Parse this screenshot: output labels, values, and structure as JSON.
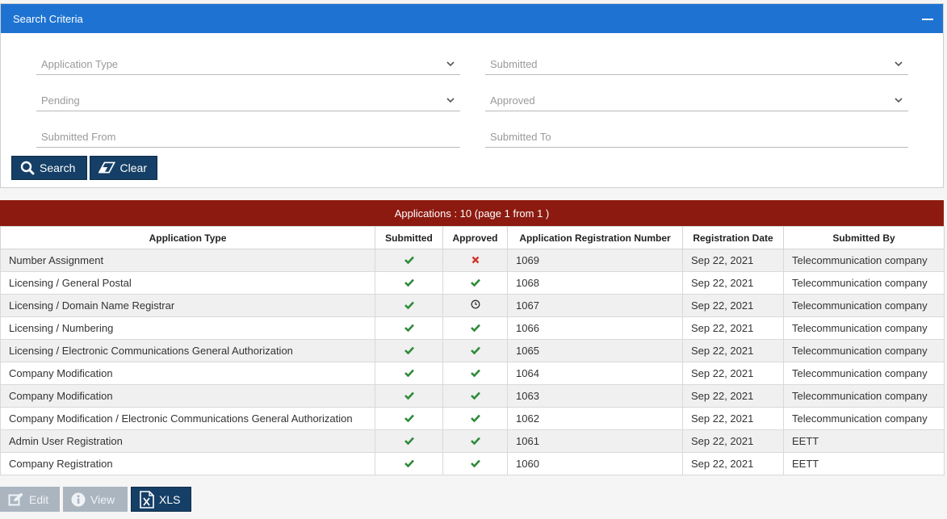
{
  "search_panel": {
    "title": "Search Criteria",
    "fields": {
      "application_type": "Application Type",
      "submitted": "Submitted",
      "pending": "Pending",
      "approved": "Approved",
      "submitted_from": "Submitted From",
      "submitted_to": "Submitted To"
    },
    "buttons": {
      "search": "Search",
      "clear": "Clear"
    }
  },
  "table": {
    "caption": "Applications : 10 (page 1 from 1 )",
    "columns": [
      "Application Type",
      "Submitted",
      "Approved",
      "Application Registration Number",
      "Registration Date",
      "Submitted By"
    ],
    "rows": [
      {
        "type": "Number Assignment",
        "submitted": "check",
        "approved": "cross",
        "number": "1069",
        "date": "Sep 22, 2021",
        "by": "Telecommunication company"
      },
      {
        "type": "Licensing / General Postal",
        "submitted": "check",
        "approved": "check",
        "number": "1068",
        "date": "Sep 22, 2021",
        "by": "Telecommunication company"
      },
      {
        "type": "Licensing / Domain Name Registrar",
        "submitted": "check",
        "approved": "clock",
        "number": "1067",
        "date": "Sep 22, 2021",
        "by": "Telecommunication company"
      },
      {
        "type": "Licensing / Numbering",
        "submitted": "check",
        "approved": "check",
        "number": "1066",
        "date": "Sep 22, 2021",
        "by": "Telecommunication company"
      },
      {
        "type": "Licensing / Electronic Communications General Authorization",
        "submitted": "check",
        "approved": "check",
        "number": "1065",
        "date": "Sep 22, 2021",
        "by": "Telecommunication company"
      },
      {
        "type": "Company Modification",
        "submitted": "check",
        "approved": "check",
        "number": "1064",
        "date": "Sep 22, 2021",
        "by": "Telecommunication company"
      },
      {
        "type": "Company Modification",
        "submitted": "check",
        "approved": "check",
        "number": "1063",
        "date": "Sep 22, 2021",
        "by": "Telecommunication company"
      },
      {
        "type": "Company Modification / Electronic Communications General Authorization",
        "submitted": "check",
        "approved": "check",
        "number": "1062",
        "date": "Sep 22, 2021",
        "by": "Telecommunication company"
      },
      {
        "type": "Admin User Registration",
        "submitted": "check",
        "approved": "check",
        "number": "1061",
        "date": "Sep 22, 2021",
        "by": "EETT"
      },
      {
        "type": "Company Registration",
        "submitted": "check",
        "approved": "check",
        "number": "1060",
        "date": "Sep 22, 2021",
        "by": "EETT"
      }
    ]
  },
  "footer": {
    "edit": "Edit",
    "view": "View",
    "xls": "XLS"
  },
  "colors": {
    "header_blue": "#1e73d2",
    "caption_red": "#8c1a10",
    "button_navy": "#153f66",
    "check_green": "#2e8b3a",
    "cross_red": "#d0342c"
  }
}
